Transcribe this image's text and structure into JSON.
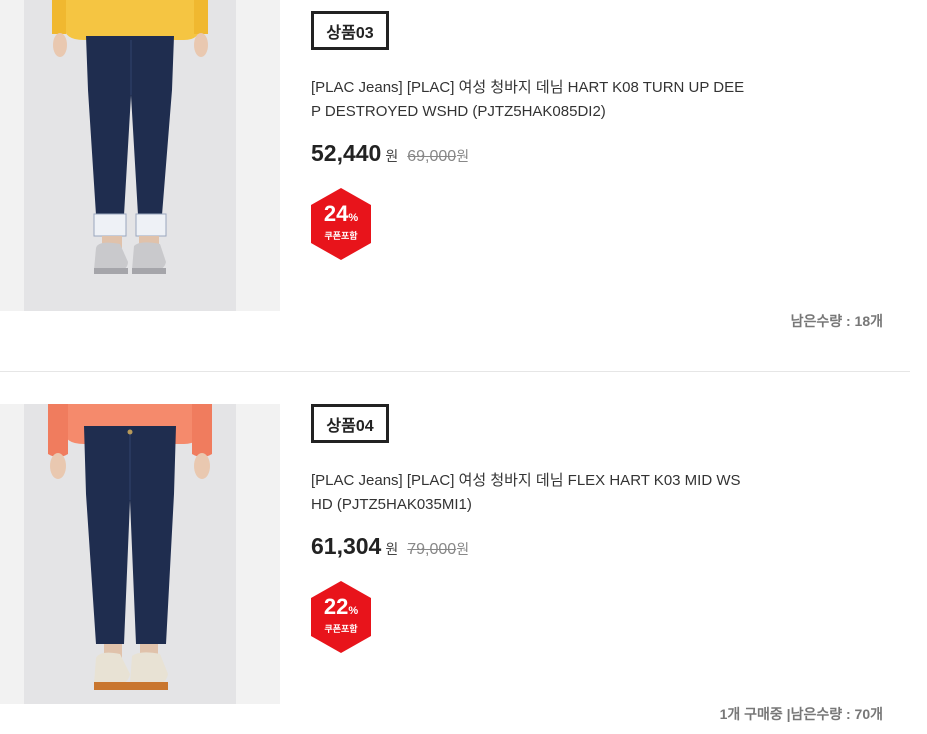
{
  "products": [
    {
      "tag": "상품03",
      "title": "[PLAC Jeans] [PLAC] 여성 청바지 데님 HART K08 TURN UP DEEP DESTROYED WSHD (PJTZ5HAK085DI2)",
      "price": "52,440",
      "price_unit": "원",
      "original_price": "69,000",
      "original_unit": "원",
      "discount_number": "24",
      "discount_unit": "%",
      "coupon_label": "쿠폰포함",
      "stock_text": "남은수량 : 18개",
      "sweater_color": "#f5c542"
    },
    {
      "tag": "상품04",
      "title": "[PLAC Jeans] [PLAC] 여성 청바지 데님 FLEX HART K03 MID WSHD (PJTZ5HAK035MI1)",
      "price": "61,304",
      "price_unit": "원",
      "original_price": "79,000",
      "original_unit": "원",
      "discount_number": "22",
      "discount_unit": "%",
      "coupon_label": "쿠폰포함",
      "stock_text": "1개 구매중 |남은수량 : 70개",
      "sweater_color": "#f58a6c"
    }
  ],
  "colors": {
    "badge": "#e8141b",
    "denim": "#1f2d4f",
    "denim_dark": "#162240"
  }
}
